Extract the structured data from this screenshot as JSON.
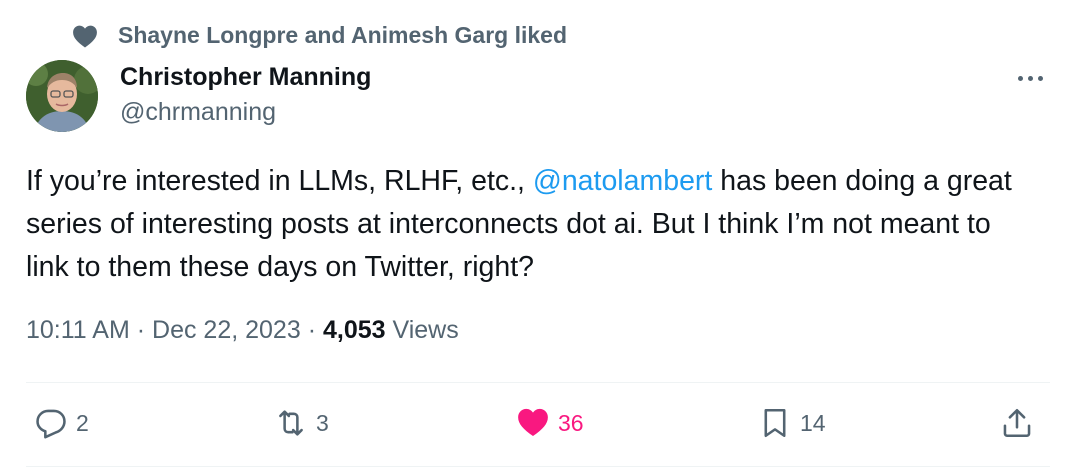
{
  "social_context": {
    "text": "Shayne Longpre and Animesh Garg liked"
  },
  "author": {
    "name": "Christopher Manning",
    "handle": "@chrmanning"
  },
  "tweet": {
    "text_before": "If you’re interested in LLMs, RLHF, etc., ",
    "mention": "@natolambert",
    "text_after": " has been doing a great series of interesting posts at interconnects dot ai. But I think I’m not meant to link to them these days on Twitter, right?"
  },
  "meta": {
    "time": "10:11 AM",
    "separator": "·",
    "date": "Dec 22, 2023",
    "views_count": "4,053",
    "views_label": "Views"
  },
  "actions": {
    "replies": "2",
    "retweets": "3",
    "likes": "36",
    "bookmarks": "14"
  },
  "colors": {
    "accent": "#1d9bf0",
    "like": "#f91880",
    "secondary_text": "#536471"
  },
  "icons": [
    "heart-icon",
    "more-icon",
    "reply-icon",
    "retweet-icon",
    "like-icon",
    "bookmark-icon",
    "share-icon"
  ]
}
